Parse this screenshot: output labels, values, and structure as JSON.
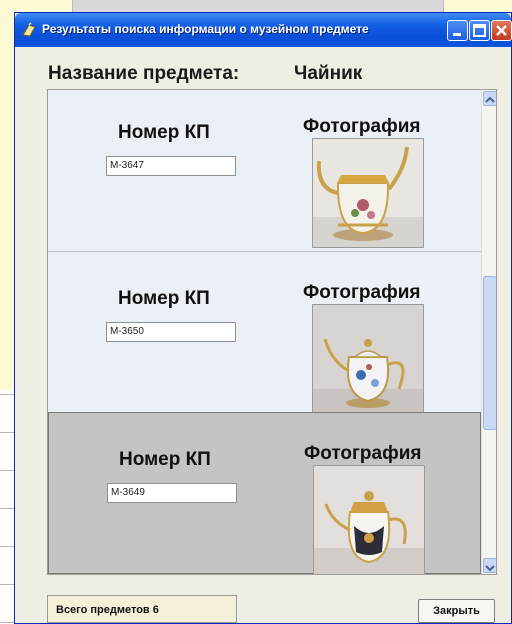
{
  "window": {
    "title": "Результаты поиска информации о музейном предмете",
    "controls": {
      "minimize_icon": "minimize-icon",
      "maximize_icon": "maximize-icon",
      "close_icon": "close-icon"
    }
  },
  "header": {
    "name_label": "Название предмета:",
    "name_value": "Чайник"
  },
  "records": [
    {
      "kp_label": "Номер КП",
      "kp_value": "М-3647",
      "photo_label": "Фотография",
      "photo_icon": "teapot-photo",
      "selected": false
    },
    {
      "kp_label": "Номер КП",
      "kp_value": "М-3650",
      "photo_label": "Фотография",
      "photo_icon": "teapot-photo",
      "selected": false
    },
    {
      "kp_label": "Номер КП",
      "kp_value": "М-3649",
      "photo_label": "Фотография",
      "photo_icon": "teapot-photo",
      "selected": true
    }
  ],
  "footer": {
    "total_text": "Всего предметов 6",
    "close_label": "Закрыть"
  },
  "colors": {
    "titlebar": "#0a4fd8",
    "record_bg": "#ebeff6",
    "selected_bg": "#c4c4c4",
    "background": "#fcfbd6"
  }
}
